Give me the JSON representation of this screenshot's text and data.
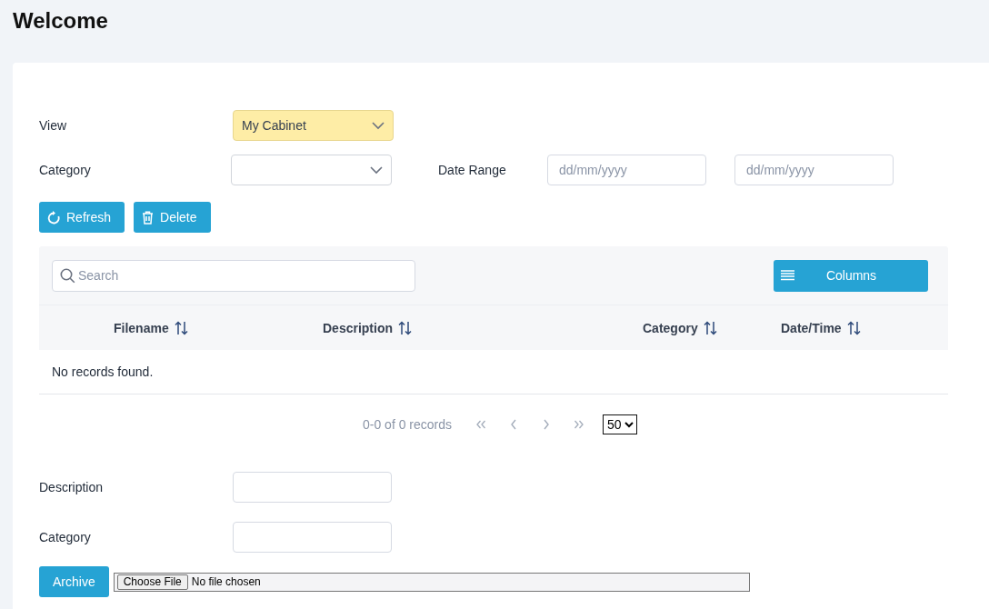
{
  "page": {
    "title": "Welcome"
  },
  "filters": {
    "view": {
      "label": "View",
      "value": "My Cabinet",
      "highlighted": true
    },
    "category": {
      "label": "Category",
      "highlighted": false
    },
    "date_range": {
      "label": "Date Range",
      "from_placeholder": "dd/mm/yyyy",
      "to_placeholder": "dd/mm/yyyy"
    }
  },
  "actions": [
    {
      "label": "Refresh",
      "kind": "refresh"
    },
    {
      "label": "Delete",
      "kind": "delete"
    }
  ],
  "table": {
    "search": {
      "placeholder": "Search"
    },
    "columns_button": "Columns",
    "columns": [
      "Filename",
      "Description",
      "Category",
      "Date/Time"
    ],
    "empty_message": "No records found."
  },
  "paginator": {
    "summary": "0-0 of 0 records",
    "nav": [
      {
        "kind": "first",
        "disabled": true
      },
      {
        "kind": "previous",
        "disabled": true
      },
      {
        "kind": "next",
        "disabled": true
      },
      {
        "kind": "last",
        "disabled": true
      }
    ],
    "page_size": "50"
  },
  "upload": {
    "fields": [
      {
        "label": "Description"
      },
      {
        "label": "Category"
      }
    ],
    "button": "Archive",
    "file": {
      "button": "Choose File",
      "status": "No file chosen"
    }
  }
}
